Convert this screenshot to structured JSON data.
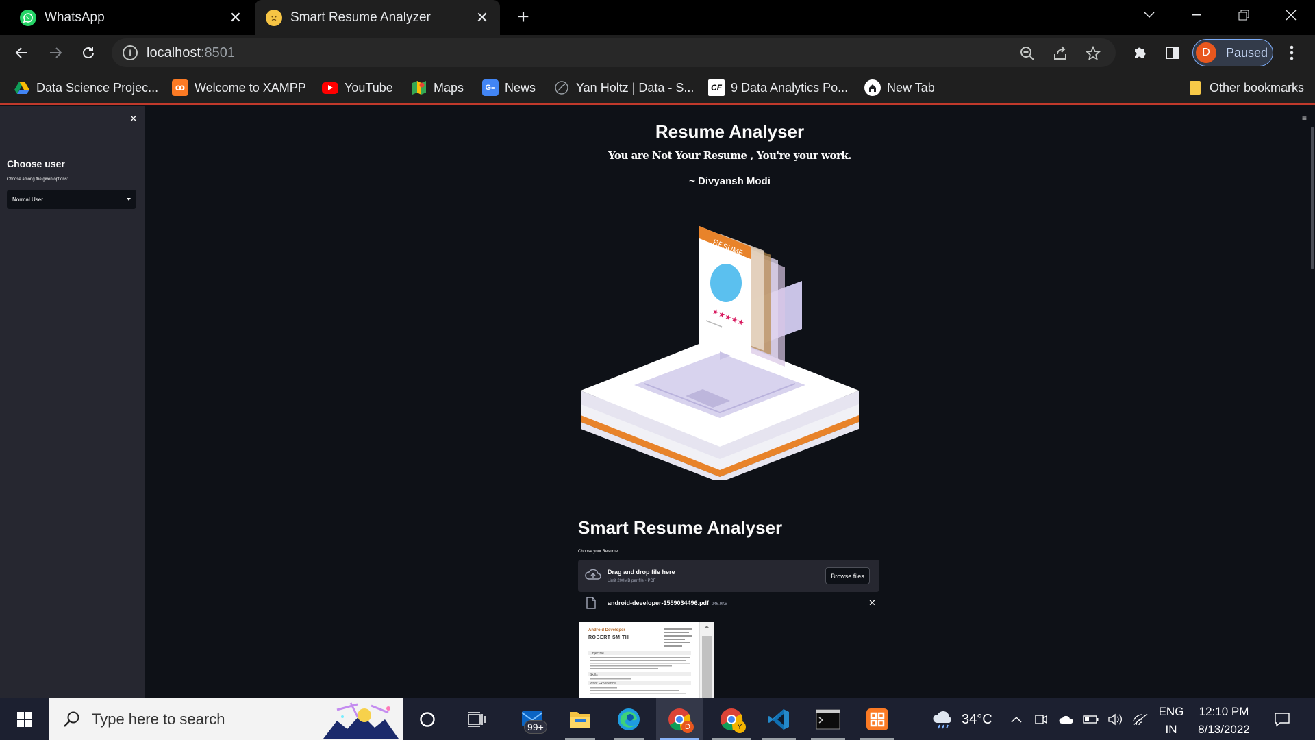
{
  "browser": {
    "tabs": [
      {
        "title": "WhatsApp",
        "icon": "whatsapp-icon",
        "active": false
      },
      {
        "title": "Smart Resume Analyzer",
        "icon": "confused-emoji-icon",
        "active": true
      }
    ],
    "url_host": "localhost",
    "url_port": ":8501",
    "profile_initial": "D",
    "profile_status": "Paused",
    "bookmarks": [
      {
        "label": "Data Science Projec...",
        "icon": "google-drive-icon"
      },
      {
        "label": "Welcome to XAMPP",
        "icon": "xampp-icon"
      },
      {
        "label": "YouTube",
        "icon": "youtube-icon"
      },
      {
        "label": "Maps",
        "icon": "google-maps-icon"
      },
      {
        "label": "News",
        "icon": "google-news-icon"
      },
      {
        "label": "Yan Holtz | Data - S...",
        "icon": "globe-icon"
      },
      {
        "label": "9 Data Analytics Po...",
        "icon": "cf-icon"
      },
      {
        "label": "New Tab",
        "icon": "home-icon"
      }
    ],
    "other_bookmarks": "Other bookmarks"
  },
  "sidebar": {
    "title": "Choose user",
    "hint": "Choose among the given options:",
    "selected": "Normal User"
  },
  "main": {
    "heading": "Resume Analyser",
    "quote": "You are Not Your Resume , You're your work.",
    "author": "~ Divyansh Modi",
    "section_title": "Smart Resume Analyser",
    "upload_label": "Choose your Resume",
    "dropzone_main": "Drag and drop file here",
    "dropzone_limit": "Limit 200MB per file • PDF",
    "browse_label": "Browse files",
    "file_name": "android-developer-1559034496.pdf",
    "file_size": "246.9KB",
    "pdf_preview": {
      "role": "Android Developer",
      "name": "ROBERT SMITH",
      "sections": [
        "Objective",
        "Skills",
        "Work Experience"
      ]
    },
    "hero_badge": "RESUME"
  },
  "taskbar": {
    "search_placeholder": "Type here to search",
    "mail_badge": "99+",
    "weather": "34°C",
    "lang_1": "ENG",
    "lang_2": "IN",
    "time": "12:10 PM",
    "date": "8/13/2022"
  },
  "colors": {
    "app_bg": "#0e1117",
    "sidebar_bg": "#262730",
    "accent_orange": "#e8832a",
    "chrome_dark": "#1f1f1f"
  }
}
